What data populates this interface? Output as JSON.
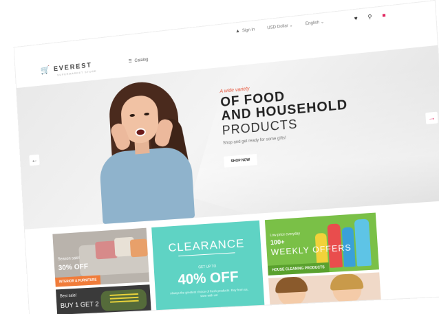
{
  "topbar": {
    "signin_label": "Sign in",
    "currency": "USD Dollar",
    "language": "English"
  },
  "header": {
    "logo_name": "EVEREST",
    "logo_tagline": "SUPERMARKET STORE",
    "nav_catalog": "Catalog"
  },
  "hero": {
    "kicker": "A wide variety",
    "headline_line1": "OF FOOD",
    "headline_line2": "AND HOUSEHOLD",
    "headline_line3": "PRODUCTS",
    "subtitle": "Shop and get ready for some gifts!",
    "button_label": "SHOP NOW"
  },
  "banners": {
    "furniture": {
      "small": "Season sale!",
      "big": "30% OFF",
      "label": "INTERIOR & FURNITURE"
    },
    "clearance": {
      "title": "CLEARANCE",
      "upto": "GET UP TO",
      "percent": "40% OFF",
      "description": "Always the greatest choice of fresh products. Buy from us, save with us!"
    },
    "cleaning": {
      "small": "Low price everyday",
      "count": "100+",
      "big": "WEEKLY OFFERS",
      "label": "HOUSE CLEANING PRODUCTS"
    },
    "shoes": {
      "small": "Best sale!",
      "big": "BUY 1 GET 2"
    }
  },
  "colors": {
    "accent": "#e8543a",
    "clearance_bg": "#5fd3c4",
    "cleaning_bg": "#7ac047",
    "furniture_label": "#f07c3a"
  },
  "icons": [
    "user-icon",
    "heart-icon",
    "search-icon",
    "cart-icon",
    "chevron-left-icon",
    "chevron-right-icon",
    "catalog-icon"
  ]
}
